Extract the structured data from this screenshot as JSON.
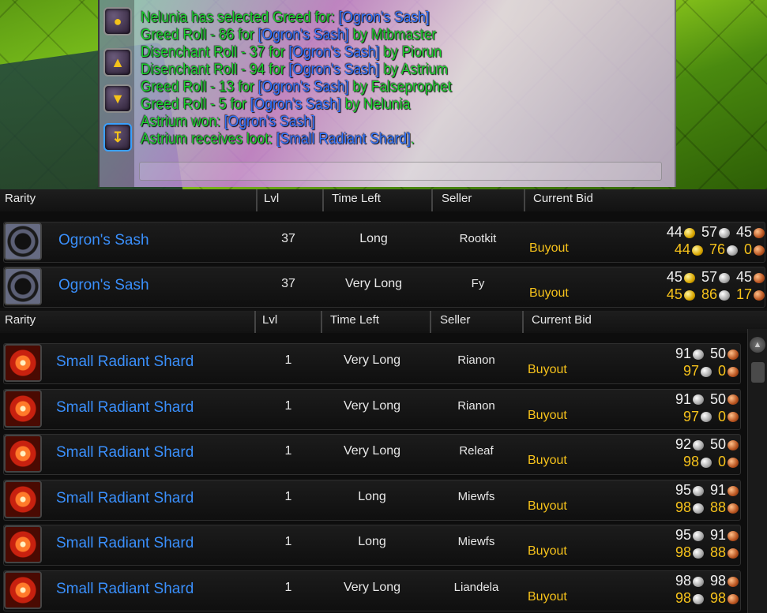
{
  "chat": {
    "buttons": [
      "chat-bubble-icon",
      "scroll-up-icon",
      "scroll-down-icon",
      "scroll-bottom-icon"
    ],
    "lines": [
      {
        "parts": [
          {
            "t": "Nelunia has selected Greed for: ",
            "c": "green"
          },
          {
            "t": "[Ogron's Sash]",
            "c": "blue"
          }
        ]
      },
      {
        "parts": [
          {
            "t": "Greed Roll - 86 for ",
            "c": "green"
          },
          {
            "t": "[Ogron's Sash]",
            "c": "blue"
          },
          {
            "t": " by Mtbmaster",
            "c": "green"
          }
        ]
      },
      {
        "parts": [
          {
            "t": "Disenchant Roll - 37 for ",
            "c": "green"
          },
          {
            "t": "[Ogron's Sash]",
            "c": "blue"
          },
          {
            "t": " by Piorun",
            "c": "green"
          }
        ]
      },
      {
        "parts": [
          {
            "t": "Disenchant Roll - 94 for ",
            "c": "green"
          },
          {
            "t": "[Ogron's Sash]",
            "c": "blue"
          },
          {
            "t": " by Astrium",
            "c": "green"
          }
        ]
      },
      {
        "parts": [
          {
            "t": "Greed Roll - 13 for ",
            "c": "green"
          },
          {
            "t": "[Ogron's Sash]",
            "c": "blue"
          },
          {
            "t": " by Falseprophet",
            "c": "green"
          }
        ]
      },
      {
        "parts": [
          {
            "t": "Greed Roll - 5 for ",
            "c": "green"
          },
          {
            "t": "[Ogron's Sash]",
            "c": "blue"
          },
          {
            "t": " by Nelunia",
            "c": "green"
          }
        ]
      },
      {
        "parts": [
          {
            "t": "Astrium won: ",
            "c": "green"
          },
          {
            "t": "[Ogron's Sash]",
            "c": "blue"
          }
        ]
      },
      {
        "parts": [
          {
            "t": "Astrium receives loot: ",
            "c": "green"
          },
          {
            "t": "[Small Radiant Shard]",
            "c": "blue"
          },
          {
            "t": ".",
            "c": "green"
          }
        ]
      }
    ]
  },
  "columns": {
    "rarity": "Rarity",
    "lvl": "Lvl",
    "time_left": "Time Left",
    "seller": "Seller",
    "current_bid": "Current Bid"
  },
  "buyout_label": "Buyout",
  "table1": {
    "rows": [
      {
        "icon": "sash-icon",
        "name": "Ogron's Sash",
        "lvl": "37",
        "time": "Long",
        "seller": "Rootkit",
        "bid": [
          {
            "v": "44",
            "coin": "gold"
          },
          {
            "v": "57",
            "coin": "silver"
          },
          {
            "v": "45",
            "coin": "copper"
          }
        ],
        "buyout": [
          {
            "v": "44",
            "coin": "gold"
          },
          {
            "v": "76",
            "coin": "silver"
          },
          {
            "v": "0",
            "coin": "copper"
          }
        ]
      },
      {
        "icon": "sash-icon",
        "name": "Ogron's Sash",
        "lvl": "37",
        "time": "Very Long",
        "seller": "Fy",
        "bid": [
          {
            "v": "45",
            "coin": "gold"
          },
          {
            "v": "57",
            "coin": "silver"
          },
          {
            "v": "45",
            "coin": "copper"
          }
        ],
        "buyout": [
          {
            "v": "45",
            "coin": "gold"
          },
          {
            "v": "86",
            "coin": "silver"
          },
          {
            "v": "17",
            "coin": "copper"
          }
        ]
      }
    ]
  },
  "table2": {
    "rows": [
      {
        "icon": "shard-icon",
        "name": "Small Radiant Shard",
        "lvl": "1",
        "time": "Very Long",
        "seller": "Rianon",
        "bid": [
          {
            "v": "91",
            "coin": "silver"
          },
          {
            "v": "50",
            "coin": "copper"
          }
        ],
        "buyout": [
          {
            "v": "97",
            "coin": "silver"
          },
          {
            "v": "0",
            "coin": "copper"
          }
        ]
      },
      {
        "icon": "shard-icon",
        "name": "Small Radiant Shard",
        "lvl": "1",
        "time": "Very Long",
        "seller": "Rianon",
        "bid": [
          {
            "v": "91",
            "coin": "silver"
          },
          {
            "v": "50",
            "coin": "copper"
          }
        ],
        "buyout": [
          {
            "v": "97",
            "coin": "silver"
          },
          {
            "v": "0",
            "coin": "copper"
          }
        ]
      },
      {
        "icon": "shard-icon",
        "name": "Small Radiant Shard",
        "lvl": "1",
        "time": "Very Long",
        "seller": "Releaf",
        "bid": [
          {
            "v": "92",
            "coin": "silver"
          },
          {
            "v": "50",
            "coin": "copper"
          }
        ],
        "buyout": [
          {
            "v": "98",
            "coin": "silver"
          },
          {
            "v": "0",
            "coin": "copper"
          }
        ]
      },
      {
        "icon": "shard-icon",
        "name": "Small Radiant Shard",
        "lvl": "1",
        "time": "Long",
        "seller": "Miewfs",
        "bid": [
          {
            "v": "95",
            "coin": "silver"
          },
          {
            "v": "91",
            "coin": "copper"
          }
        ],
        "buyout": [
          {
            "v": "98",
            "coin": "silver"
          },
          {
            "v": "88",
            "coin": "copper"
          }
        ]
      },
      {
        "icon": "shard-icon",
        "name": "Small Radiant Shard",
        "lvl": "1",
        "time": "Long",
        "seller": "Miewfs",
        "bid": [
          {
            "v": "95",
            "coin": "silver"
          },
          {
            "v": "91",
            "coin": "copper"
          }
        ],
        "buyout": [
          {
            "v": "98",
            "coin": "silver"
          },
          {
            "v": "88",
            "coin": "copper"
          }
        ]
      },
      {
        "icon": "shard-icon",
        "name": "Small Radiant Shard",
        "lvl": "1",
        "time": "Very Long",
        "seller": "Liandela",
        "bid": [
          {
            "v": "98",
            "coin": "silver"
          },
          {
            "v": "98",
            "coin": "copper"
          }
        ],
        "buyout": [
          {
            "v": "98",
            "coin": "silver"
          },
          {
            "v": "98",
            "coin": "copper"
          }
        ]
      }
    ]
  },
  "colors": {
    "chat_green": "#19d12b",
    "chat_blue": "#2e73ff",
    "item_name": "#3a8ffb",
    "buyout": "#f6c21b"
  }
}
